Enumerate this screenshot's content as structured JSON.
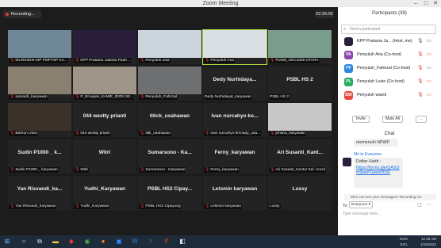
{
  "window": {
    "title": "Zoom Meeting"
  },
  "recording": {
    "label": "Recording..."
  },
  "timer": {
    "value": "02:25:00"
  },
  "tiles": [
    {
      "label": "MURSIDIN-SIP PMPTSP KA...",
      "big": "",
      "muted": true,
      "bg": "#6f8797"
    },
    {
      "label": "KPP Pratama Jakarta Pade...",
      "big": "",
      "muted": true,
      "bg": "#2a1f3a"
    },
    {
      "label": "Penyuluh usia",
      "big": "",
      "muted": true,
      "bg": "#cdd5dc"
    },
    {
      "label": "Penyuluh Ana",
      "big": "",
      "muted": true,
      "bg": "#d9dee2",
      "selected": true
    },
    {
      "label": "P1000_KEC1000 UTARA",
      "big": "",
      "muted": true,
      "bg": "#7a9c8c"
    },
    {
      "label": "sumardi_karyawan",
      "big": "",
      "muted": true,
      "bg": "#8a8070"
    },
    {
      "label": "P_Eroupan_KAWE_IDON SE...",
      "big": "",
      "muted": true,
      "bg": "#9e9487"
    },
    {
      "label": "Penyuluh_Fahrizal",
      "big": "",
      "muted": true,
      "bg": "#6d6f71"
    },
    {
      "label": "Dedy Nurhidayat_karyawan",
      "big": "Dedy Nurhidaya...",
      "muted": false,
      "bg": ""
    },
    {
      "label": "PSBL HS 2",
      "big": "PSBL HS 2",
      "muted": false,
      "bg": ""
    },
    {
      "label": "Bahrun Ulum",
      "big": "",
      "muted": true,
      "bg": "#3a3228"
    },
    {
      "label": "044 westty prianti",
      "big": "044 westty prianti",
      "muted": true,
      "bg": ""
    },
    {
      "label": "titik_usahawan",
      "big": "titick_usahawan",
      "muted": true,
      "bg": ""
    },
    {
      "label": "Ivan nurcahyo Ilmnady_usa...",
      "big": "Ivan nurcahyo ko...",
      "muted": true,
      "bg": ""
    },
    {
      "label": "johana_karyawan",
      "big": "",
      "muted": true,
      "bg": "#c8c8c8"
    },
    {
      "label": "Sudin P1000 _ karyawan",
      "big": "Sudin P1000 _ k...",
      "muted": true,
      "bg": ""
    },
    {
      "label": "Witri",
      "big": "Witri",
      "muted": true,
      "bg": ""
    },
    {
      "label": "Sumarsono - Karyawan",
      "big": "Sumarsono - Ka...",
      "muted": true,
      "bg": ""
    },
    {
      "label": "Ferny_karyawan",
      "big": "Ferny_karyawan",
      "muted": true,
      "bg": ""
    },
    {
      "label": "Ari Susanti_Kantor Kel. Ancol",
      "big": "Ari Susanti_Kant...",
      "muted": true,
      "bg": ""
    },
    {
      "label": "Yan Risvandi_karyawan",
      "big": "Yan Risvandi_ka...",
      "muted": true,
      "bg": ""
    },
    {
      "label": "Yudhi_Karyawan",
      "big": "Yudhi_Karyawan",
      "muted": true,
      "bg": ""
    },
    {
      "label": "PSBL HS2 Cipayung",
      "big": "PSBL HS2 Cipay...",
      "muted": true,
      "bg": ""
    },
    {
      "label": "Letsmin karyawan",
      "big": "Letsmin karyawan",
      "muted": true,
      "bg": ""
    },
    {
      "label": "Lussy",
      "big": "Lussy",
      "muted": false,
      "bg": ""
    }
  ],
  "participants": {
    "title": "Participants (39)",
    "search_placeholder": "Find a participant",
    "items": [
      {
        "initials": "",
        "name": "KPP Pratama Ja... (Host, me)",
        "color": "#2a1f3a"
      },
      {
        "initials": "PA",
        "name": "Penyuluh Ana (Co-host)",
        "color": "#8e44ad"
      },
      {
        "initials": "PF",
        "name": "Penyuluh_Fahrizal (Co-host)",
        "color": "#2e86de"
      },
      {
        "initials": "PL",
        "name": "Penyuluh Lusie (Co-host)",
        "color": "#27ae60"
      },
      {
        "initials": "BW",
        "name": "Penyuluh wianti",
        "color": "#e74c3c"
      }
    ],
    "invite_label": "Invite",
    "mute_all_label": "Mute All",
    "more_label": "..."
  },
  "chat": {
    "title": "Chat",
    "msg1": "memenuhi NPWP",
    "from": "Me to Everyone",
    "msg2_title": "Daftar Hadir :",
    "msg2_link": "https://forms.gle/QASQm9wePGpwVf6S6",
    "warning": "Who can see your messages? Recording On",
    "to_label": "To:",
    "to_value": "Everyone",
    "input_placeholder": "Type message here..."
  },
  "taskbar": {
    "lang": "ENG",
    "region": "INTL",
    "time": "11:48 AM",
    "date": "1/18/2022"
  }
}
